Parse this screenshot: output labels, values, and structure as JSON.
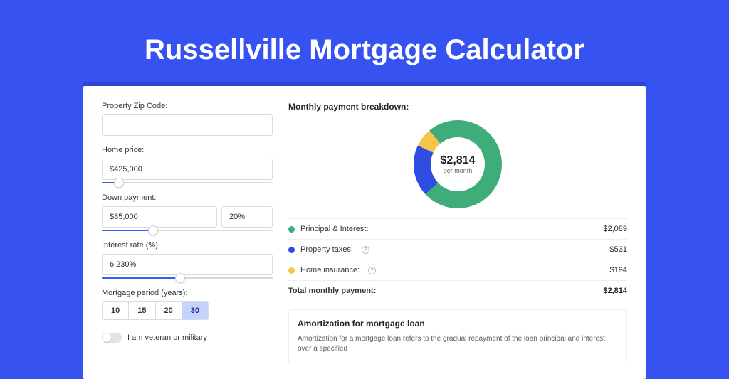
{
  "page_title": "Russellville Mortgage Calculator",
  "left": {
    "zip_label": "Property Zip Code:",
    "zip_value": "",
    "home_price_label": "Home price:",
    "home_price_value": "$425,000",
    "home_price_slider_pct": 10,
    "down_payment_label": "Down payment:",
    "down_payment_value": "$85,000",
    "down_payment_pct_value": "20%",
    "down_payment_slider_pct": 30,
    "interest_label": "Interest rate (%):",
    "interest_value": "6.230%",
    "interest_slider_pct": 46,
    "period_label": "Mortgage period (years):",
    "period_options": [
      "10",
      "15",
      "20",
      "30"
    ],
    "period_selected_index": 3,
    "veteran_label": "I am veteran or military",
    "veteran_checked": false
  },
  "right": {
    "breakdown_title": "Monthly payment breakdown:",
    "donut_amount": "$2,814",
    "donut_sub": "per month",
    "legend": [
      {
        "label": "Principal & Interest:",
        "value": "$2,089",
        "color": "#3fad7a",
        "help": false
      },
      {
        "label": "Property taxes:",
        "value": "$531",
        "color": "#2f4de0",
        "help": true
      },
      {
        "label": "Home insurance:",
        "value": "$194",
        "color": "#f3c64a",
        "help": true
      }
    ],
    "total_label": "Total monthly payment:",
    "total_value": "$2,814",
    "amort_title": "Amortization for mortgage loan",
    "amort_body": "Amortization for a mortgage loan refers to the gradual repayment of the loan principal and interest over a specified"
  },
  "chart_data": {
    "type": "pie",
    "title": "Monthly payment breakdown",
    "categories": [
      "Principal & Interest",
      "Property taxes",
      "Home insurance"
    ],
    "values": [
      2089,
      531,
      194
    ],
    "colors": [
      "#3fad7a",
      "#2f4de0",
      "#f3c64a"
    ],
    "total": 2814,
    "center_label": "$2,814 per month"
  }
}
